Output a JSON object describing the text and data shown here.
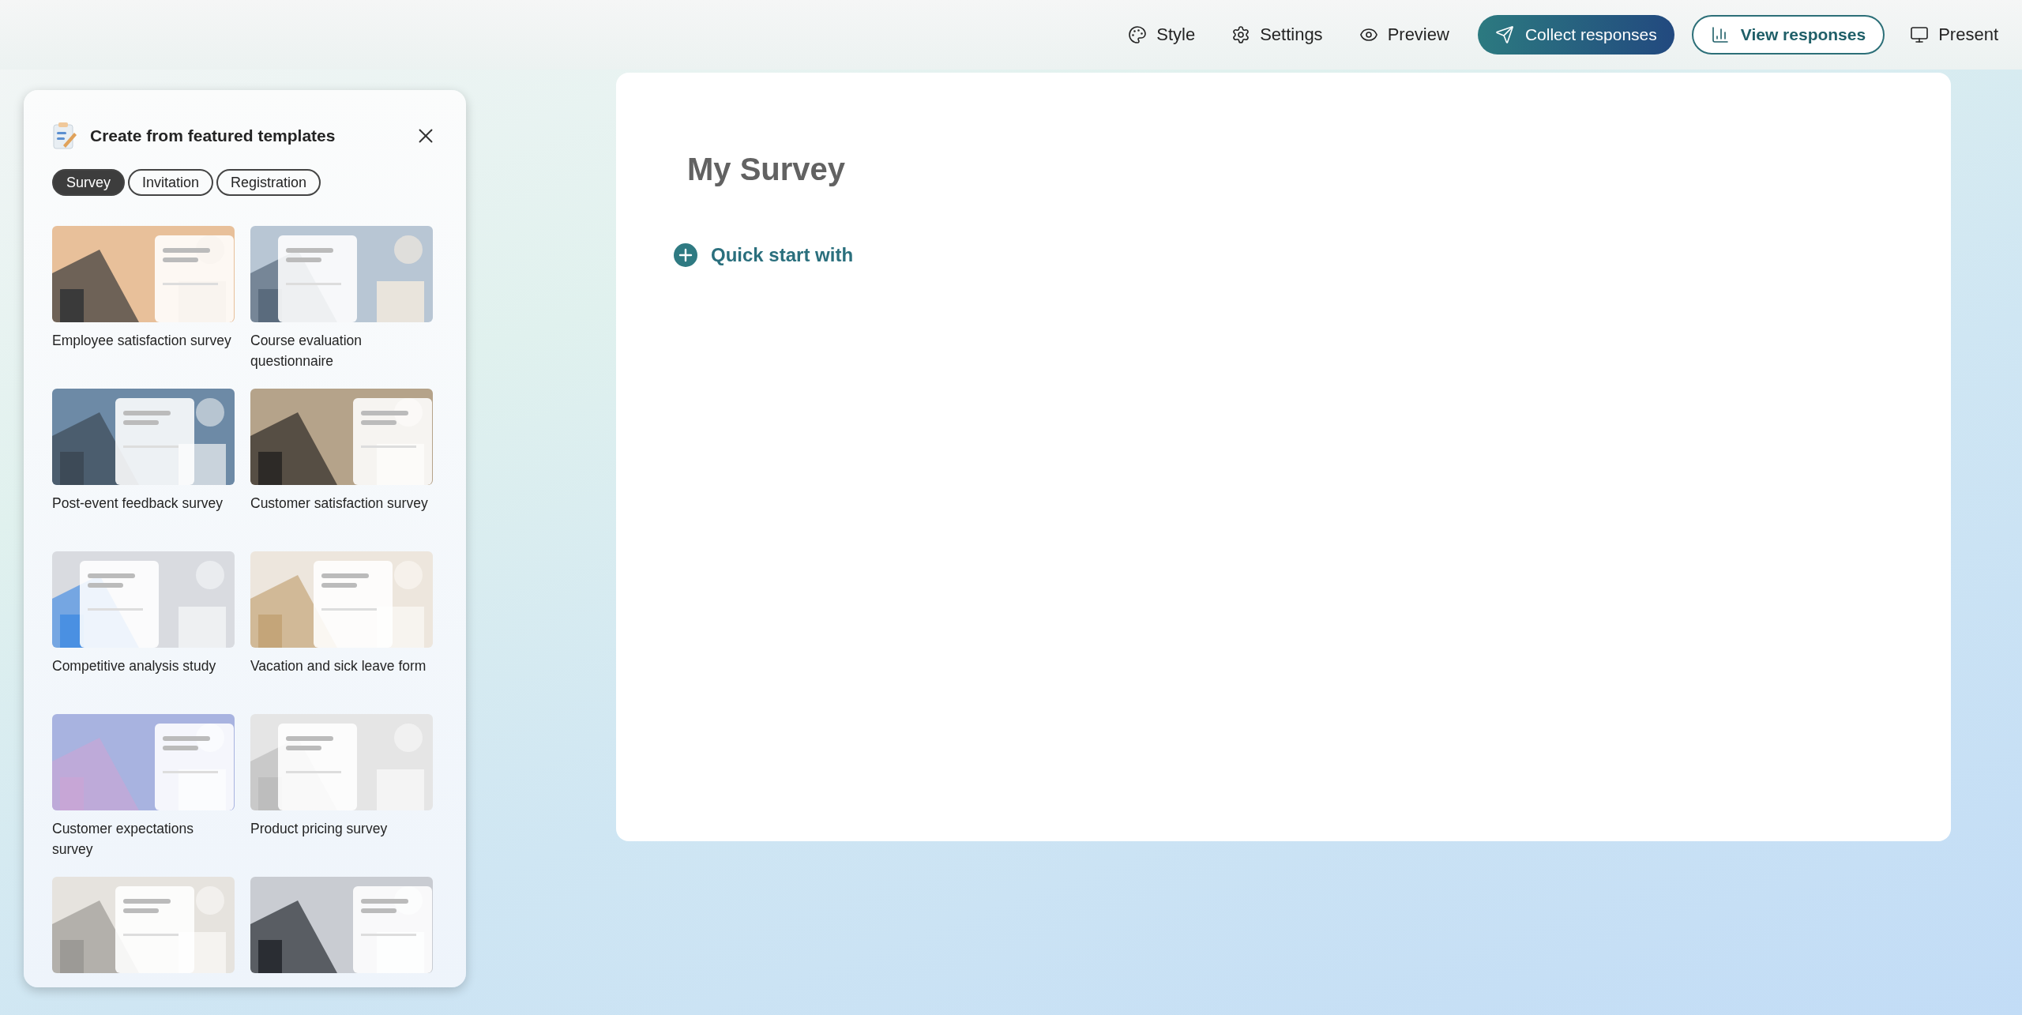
{
  "toolbar": [
    {
      "label": "Style",
      "kind": "style"
    },
    {
      "label": "Settings",
      "kind": "settings"
    },
    {
      "label": "Preview",
      "kind": "preview"
    },
    {
      "label": "Collect responses",
      "kind": "collect"
    },
    {
      "label": "View responses",
      "kind": "view"
    },
    {
      "label": "Present",
      "kind": "present"
    }
  ],
  "template_panel": {
    "title": "Create from featured templates",
    "tabs": [
      {
        "label": "Survey",
        "selected": true
      },
      {
        "label": "Invitation",
        "selected": false
      },
      {
        "label": "Registration",
        "selected": false
      }
    ],
    "templates": [
      {
        "label": "Employee satisfaction survey",
        "kind": "picture"
      },
      {
        "label": "Course evaluation questionnaire",
        "kind": "picture"
      },
      {
        "label": "Post-event feedback survey",
        "kind": "picture"
      },
      {
        "label": "Customer satisfaction survey",
        "kind": "picture"
      },
      {
        "label": "Competitive analysis study",
        "kind": "picture"
      },
      {
        "label": "Vacation and sick leave form",
        "kind": "picture"
      },
      {
        "label": "Customer expectations survey",
        "kind": "picture"
      },
      {
        "label": "Product pricing survey",
        "kind": "picture"
      },
      {
        "kind": "picture"
      },
      {
        "kind": "picture"
      }
    ]
  },
  "form": {
    "title": "My Survey",
    "quick_start": "Quick start with"
  }
}
